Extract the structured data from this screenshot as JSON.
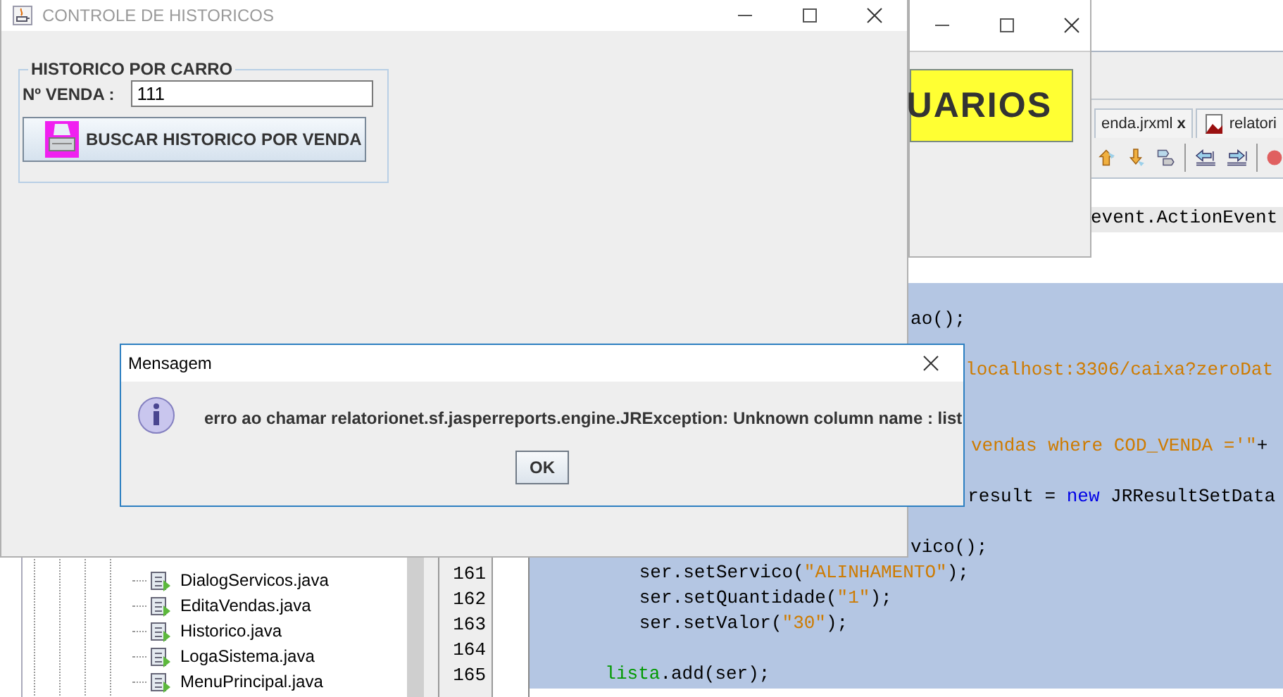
{
  "ide": {
    "tabs": [
      {
        "label": "enda.jrxml",
        "close": "x",
        "selected": false
      },
      {
        "label": "relatori",
        "selected": false
      }
    ],
    "project_files": [
      "DialogServicos.java",
      "EditaVendas.java",
      "Historico.java",
      "LogaSistema.java",
      "MenuPrincipal.java"
    ],
    "code_lines": [
      {
        "selected": false,
        "current": false
      },
      {
        "selected": false,
        "current": true,
        "segments": [
          {
            "kind": "plain",
            "text": "event.ActionEvent"
          }
        ]
      },
      {
        "selected": false,
        "current": false
      },
      {
        "selected": false,
        "current": false
      },
      {
        "selected": true,
        "current": false
      },
      {
        "selected": true,
        "current": false,
        "segments": [
          {
            "kind": "plain",
            "text": "ao();"
          }
        ]
      },
      {
        "selected": true,
        "current": false
      },
      {
        "selected": true,
        "current": false,
        "segments": [
          {
            "kind": "string",
            "text": "localhost:3306/caixa?zeroDat"
          }
        ]
      },
      {
        "selected": true,
        "current": false
      },
      {
        "selected": true,
        "current": false
      },
      {
        "selected": true,
        "current": false,
        "segments": [
          {
            "kind": "string",
            "text": "vendas where COD_VENDA ='\""
          },
          {
            "kind": "plain",
            "text": "+"
          }
        ]
      },
      {
        "selected": true,
        "current": false
      },
      {
        "selected": true,
        "current": false,
        "segments": [
          {
            "kind": "plain",
            "text": "result = "
          },
          {
            "kind": "keyword",
            "text": "new"
          },
          {
            "kind": "plain",
            "text": " JRResultSetData"
          }
        ]
      },
      {
        "selected": true,
        "current": false
      },
      {
        "selected": true,
        "current": false,
        "segments": [
          {
            "kind": "plain",
            "text": "vico();"
          }
        ]
      },
      {
        "number": "161",
        "selected": true,
        "current": false,
        "segments": [
          {
            "kind": "plain",
            "text": "ser.setServico("
          },
          {
            "kind": "string",
            "text": "\"ALINHAMENTO\""
          },
          {
            "kind": "plain",
            "text": ");"
          }
        ]
      },
      {
        "number": "162",
        "selected": true,
        "current": false,
        "segments": [
          {
            "kind": "plain",
            "text": "ser.setQuantidade("
          },
          {
            "kind": "string",
            "text": "\"1\""
          },
          {
            "kind": "plain",
            "text": ");"
          }
        ]
      },
      {
        "number": "163",
        "selected": true,
        "current": false,
        "segments": [
          {
            "kind": "plain",
            "text": "ser.setValor("
          },
          {
            "kind": "string",
            "text": "\"30\""
          },
          {
            "kind": "plain",
            "text": ");"
          }
        ]
      },
      {
        "number": "164",
        "selected": true,
        "current": false
      },
      {
        "number": "165",
        "selected": true,
        "current": false,
        "segments": [
          {
            "kind": "field",
            "text": "lista"
          },
          {
            "kind": "plain",
            "text": ".add(ser);"
          }
        ]
      }
    ]
  },
  "usuarios_window": {
    "banner": "UARIOS"
  },
  "historico_window": {
    "title": "CONTROLE DE HISTORICOS",
    "group_title": "HISTORICO POR CARRO",
    "sale_label": "Nº VENDA :",
    "sale_value": "111",
    "search_button": "BUSCAR HISTORICO POR VENDA"
  },
  "dialog": {
    "title": "Mensagem",
    "message": "erro ao chamar relatorionet.sf.jasperreports.engine.JRException: Unknown column name : list",
    "ok_button": "OK"
  }
}
